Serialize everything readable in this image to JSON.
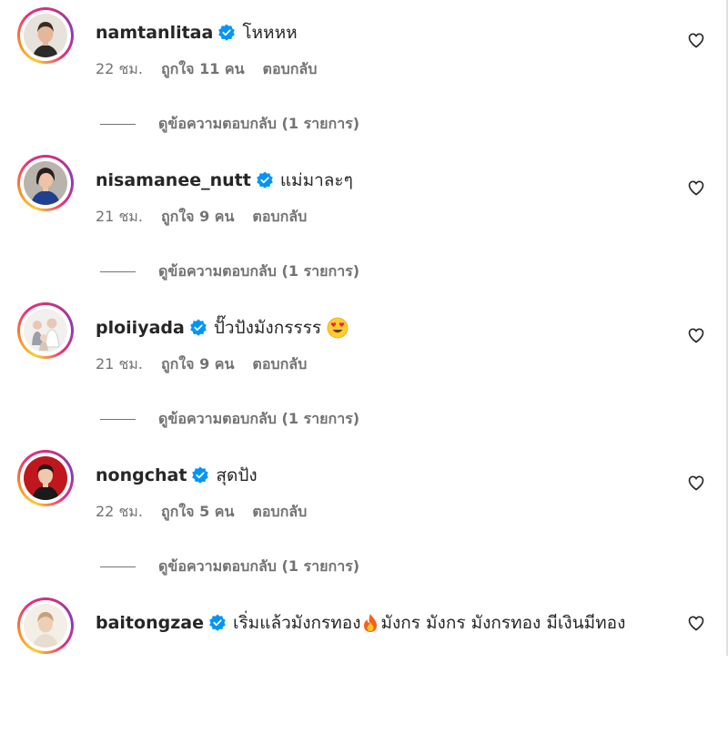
{
  "comments": [
    {
      "username": "namtanlitaa",
      "text": "โหหหห",
      "emoji": "",
      "time": "22 ชม.",
      "likes": "ถูกใจ 11 คน",
      "reply_label": "ตอบกลับ",
      "view_replies": "ดูข้อความตอบกลับ (1 รายการ)",
      "avatar": "woman-portrait-avatar"
    },
    {
      "username": "nisamanee_nutt",
      "text": "แม่มาละๆ",
      "emoji": "",
      "time": "21 ชม.",
      "likes": "ถูกใจ 9 คน",
      "reply_label": "ตอบกลับ",
      "view_replies": "ดูข้อความตอบกลับ (1 รายการ)",
      "avatar": "woman-blue-dress-avatar"
    },
    {
      "username": "ploiiyada",
      "text": "ปั๊วปังมังกรรรร",
      "emoji": "heart-eyes-emoji",
      "time": "21 ชม.",
      "likes": "ถูกใจ 9 คน",
      "reply_label": "ตอบกลับ",
      "view_replies": "ดูข้อความตอบกลับ (1 รายการ)",
      "avatar": "family-photo-avatar"
    },
    {
      "username": "nongchat",
      "text": "สุดปัง",
      "emoji": "",
      "time": "22 ชม.",
      "likes": "ถูกใจ 5 คน",
      "reply_label": "ตอบกลับ",
      "view_replies": "ดูข้อความตอบกลับ (1 รายการ)",
      "avatar": "man-red-background-avatar"
    },
    {
      "username": "baitongzae",
      "text_before": "เริ่มแล้วมังกรทอง",
      "text_after": "มังกร มังกร มังกรทอง มีเงินมีทอง",
      "emoji": "fire-emoji",
      "avatar": "light-photo-avatar"
    }
  ],
  "colors": {
    "username": "#262626",
    "meta": "#737373",
    "verified_badge": "#0095f6"
  }
}
